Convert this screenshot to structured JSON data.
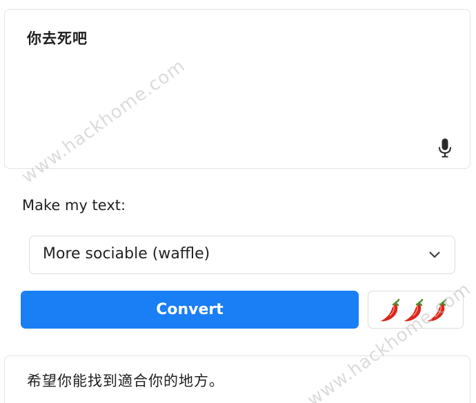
{
  "input": {
    "text": "你去死吧",
    "mic_icon": "microphone-icon"
  },
  "form": {
    "label": "Make my text:",
    "select_value": "More sociable (waffle)",
    "select_icon": "chevron-down-icon"
  },
  "actions": {
    "convert_label": "Convert",
    "spice_level": 3,
    "spice_max": 3,
    "spice_icon": "chili-pepper-icon"
  },
  "output": {
    "text": "希望你能找到適合你的地方。"
  },
  "watermark": {
    "text": "www.hackhome.com"
  },
  "colors": {
    "accent": "#1a7ef5",
    "chili_red": "#d9261c",
    "chili_stem": "#4a8a2a"
  }
}
